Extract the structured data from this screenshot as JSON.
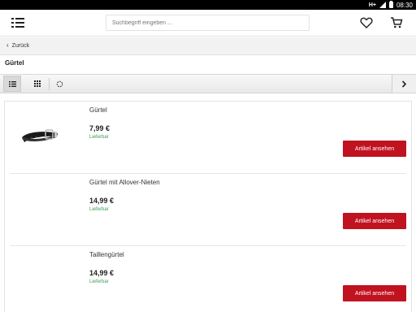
{
  "status_bar": {
    "network": "H+",
    "time": "08:30"
  },
  "header": {
    "menu_icon": "list-menu-icon",
    "search_placeholder": "Suchbegriff eingeben ...",
    "wishlist_icon": "heart-icon",
    "cart_icon": "cart-icon"
  },
  "back": {
    "label": "Zurück",
    "icon": "chevron-left-icon"
  },
  "page": {
    "title": "Gürtel"
  },
  "toolbar": {
    "buttons": [
      {
        "icon": "list-view-icon",
        "active": true
      },
      {
        "icon": "grid-view-icon",
        "active": false
      },
      {
        "icon": "refresh-icon",
        "active": false
      },
      {
        "icon": "chevron-right-icon",
        "active": false
      }
    ]
  },
  "products": [
    {
      "name": "Gürtel",
      "price": "7,99 €",
      "availability": "Lieferbar",
      "button": "Artikel ansehen",
      "has_image": true
    },
    {
      "name": "Gürtel mit Allover-Nieten",
      "price": "14,99 €",
      "availability": "Lieferbar",
      "button": "Artikel ansehen",
      "has_image": false
    },
    {
      "name": "Taillengürtel",
      "price": "14,99 €",
      "availability": "Lieferbar",
      "button": "Artikel ansehen",
      "has_image": false
    }
  ],
  "colors": {
    "accent": "#c1121f",
    "available": "#3aa053"
  }
}
